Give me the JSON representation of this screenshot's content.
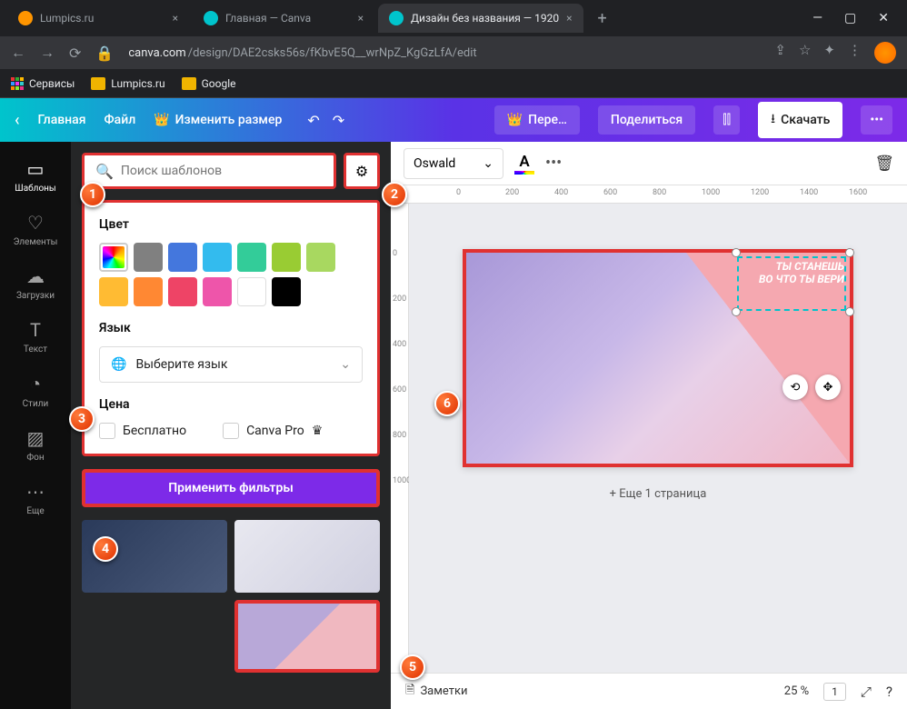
{
  "browser": {
    "tabs": [
      {
        "title": "Lumpics.ru",
        "favicon": "#ff9500"
      },
      {
        "title": "Главная — Canva",
        "favicon": "#00c4cc"
      },
      {
        "title": "Дизайн без названия — 1920",
        "favicon": "#00c4cc"
      }
    ],
    "url_prefix": "canva.com",
    "url_path": "/design/DAE2csks56s/fKbvE5Q__wrNpZ_KgGzLfA/edit",
    "bookmarks": [
      "Сервисы",
      "Lumpics.ru",
      "Google"
    ]
  },
  "topbar": {
    "home": "Главная",
    "file": "Файл",
    "resize": "Изменить размер",
    "translate": "Пере…",
    "share": "Поделиться",
    "download": "Скачать"
  },
  "sidenav": [
    {
      "label": "Шаблоны",
      "icon": "▭"
    },
    {
      "label": "Элементы",
      "icon": "♡"
    },
    {
      "label": "Загрузки",
      "icon": "☁"
    },
    {
      "label": "Текст",
      "icon": "T"
    },
    {
      "label": "Стили",
      "icon": "◔"
    },
    {
      "label": "Фон",
      "icon": "▨"
    },
    {
      "label": "Еще",
      "icon": "⋯"
    }
  ],
  "search": {
    "placeholder": "Поиск шаблонов"
  },
  "filters": {
    "color_label": "Цвет",
    "colors": [
      "#808080",
      "#4477dd",
      "#33bbee",
      "#33cc99",
      "#99cc33",
      "#a8d860",
      "#ffbb33",
      "#ff8833",
      "#ee4466",
      "#ee55aa",
      "#ffffff",
      "#000000"
    ],
    "lang_label": "Язык",
    "lang_placeholder": "Выберите язык",
    "price_label": "Цена",
    "price_free": "Бесплатно",
    "price_pro": "Canva Pro",
    "apply": "Применить фильтры"
  },
  "toolbar": {
    "font": "Oswald"
  },
  "ruler_h": [
    "0",
    "200",
    "400",
    "600",
    "800",
    "1000",
    "1200",
    "1400",
    "1600"
  ],
  "ruler_v": [
    "0",
    "200",
    "400",
    "600",
    "800",
    "1000"
  ],
  "canvas": {
    "text1": "ТЫ СТАНЕШЬ",
    "text2": "ВО ЧТО ТЫ ВЕРИ",
    "addpage": "+ Еще 1 страница"
  },
  "bottom": {
    "notes": "Заметки",
    "zoom": "25 %",
    "page": "1"
  },
  "callouts": [
    "1",
    "2",
    "3",
    "4",
    "5",
    "6"
  ]
}
